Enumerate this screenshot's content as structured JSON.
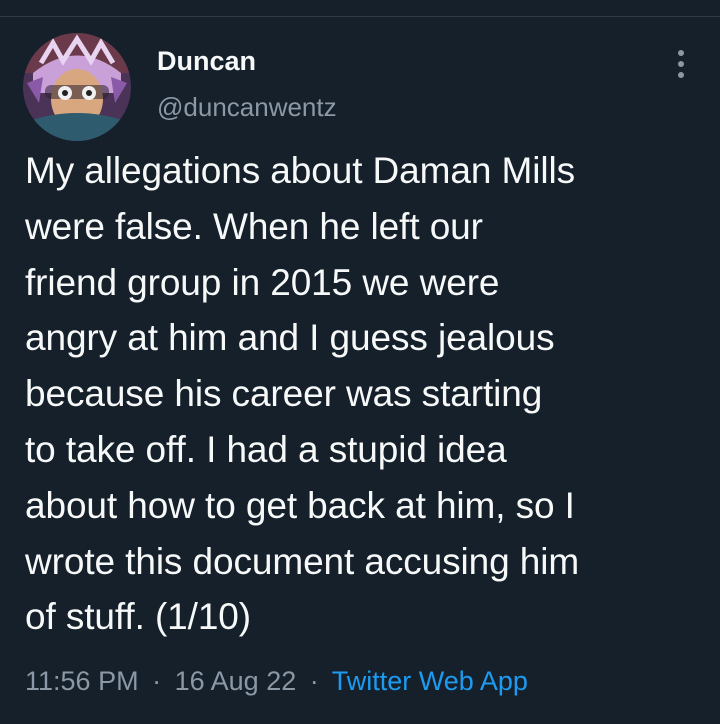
{
  "author": {
    "display_name": "Duncan",
    "handle": "@duncanwentz",
    "avatar_icon": "illustrated-portrait-avatar"
  },
  "menu": {
    "icon": "vertical-ellipsis-icon"
  },
  "tweet": {
    "lines": [
      "My allegations about Daman Mills",
      "were false. When he left our",
      "friend group in 2015 we were",
      "angry at him and I guess jealous",
      "because his career was starting",
      "to take off. I had a stupid idea",
      "about how to get back at him, so I",
      "wrote this document accusing him",
      "of stuff. (1/10)"
    ]
  },
  "meta": {
    "time": "11:56 PM",
    "separator": "·",
    "date": "16 Aug 22",
    "source": "Twitter Web App"
  },
  "colors": {
    "background": "#15202b",
    "primary_text": "#f7f9f9",
    "secondary_text": "#8b98a5",
    "link": "#1d9bf0"
  }
}
